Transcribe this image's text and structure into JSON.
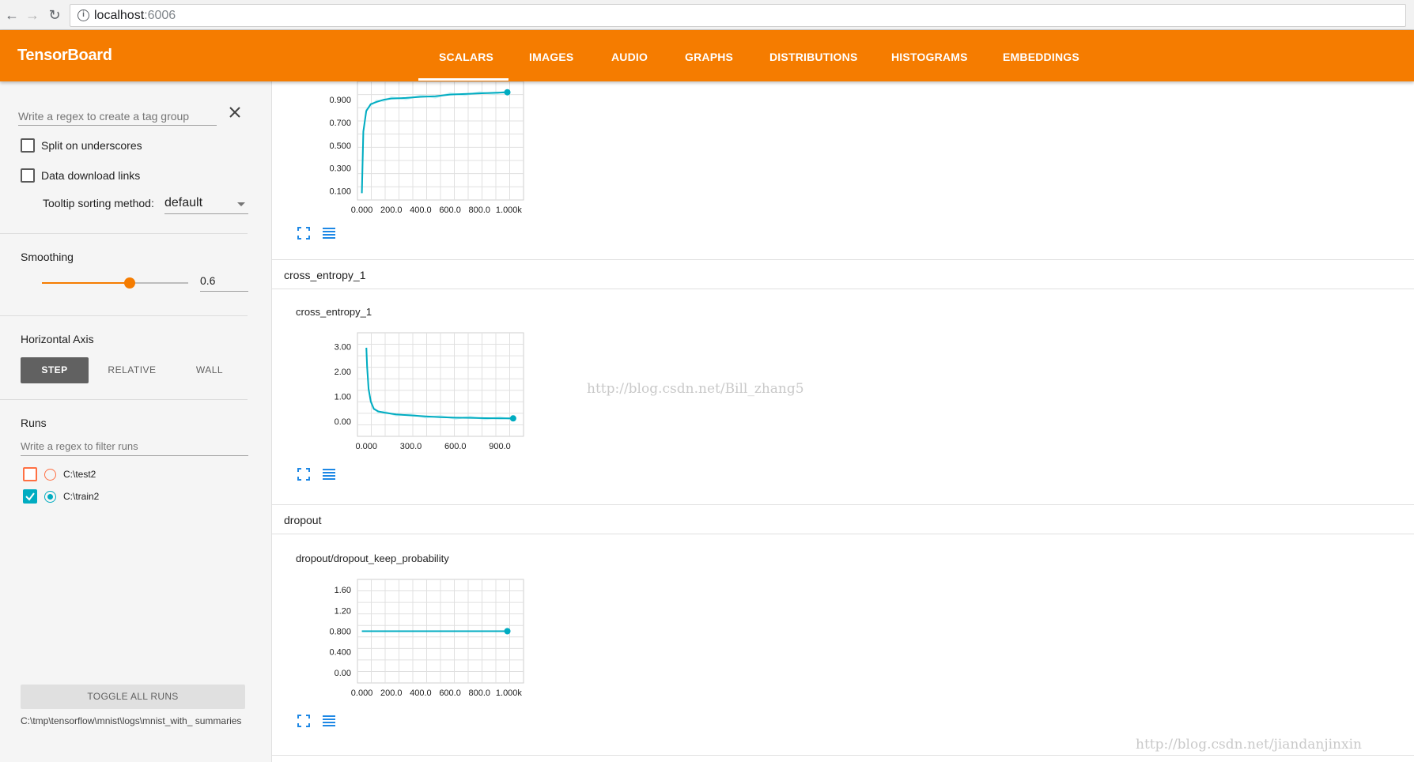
{
  "browser": {
    "url_host": "localhost",
    "url_port": ":6006",
    "back_icon": "back-arrow-icon",
    "forward_icon": "forward-arrow-icon",
    "reload_icon": "reload-icon"
  },
  "header": {
    "brand": "TensorBoard",
    "tabs": [
      "SCALARS",
      "IMAGES",
      "AUDIO",
      "GRAPHS",
      "DISTRIBUTIONS",
      "HISTOGRAMS",
      "EMBEDDINGS"
    ],
    "active_tab": "SCALARS",
    "colors": {
      "header_bg": "#f57c00",
      "accent": "#00acc1"
    }
  },
  "sidebar": {
    "tag_regex_placeholder": "Write a regex to create a tag group",
    "split_label": "Split on underscores",
    "download_label": "Data download links",
    "tooltip_label": "Tooltip sorting method:",
    "tooltip_value": "default",
    "smoothing_title": "Smoothing",
    "smoothing_value": "0.6",
    "smoothing_fraction": 0.6,
    "axis_title": "Horizontal Axis",
    "axis_options": [
      "STEP",
      "RELATIVE",
      "WALL"
    ],
    "axis_selected": "STEP",
    "runs_title": "Runs",
    "runs_placeholder": "Write a regex to filter runs",
    "runs": [
      {
        "name": "C:\\test2",
        "checked": false,
        "color": "#ff7043"
      },
      {
        "name": "C:\\train2",
        "checked": true,
        "color": "#00acc1"
      }
    ],
    "toggle_label": "TOGGLE ALL RUNS",
    "logdir": "C:\\tmp\\tensorflow\\mnist\\logs\\mnist_with_ summaries"
  },
  "groups": [
    {
      "title": "cross_entropy_1"
    },
    {
      "title": "dropout"
    }
  ],
  "chart_data": [
    {
      "type": "line",
      "title": "",
      "x": [
        0,
        10,
        30,
        60,
        100,
        150,
        200,
        300,
        400,
        500,
        600,
        700,
        800,
        900,
        990
      ],
      "series": [
        {
          "values": [
            0.08,
            0.62,
            0.8,
            0.86,
            0.88,
            0.9,
            0.91,
            0.915,
            0.925,
            0.93,
            0.945,
            0.95,
            0.955,
            0.96,
            0.965
          ]
        }
      ],
      "x_ticks": [
        "0.000",
        "200.0",
        "400.0",
        "600.0",
        "800.0",
        "1.000k"
      ],
      "y_ticks": [
        "0.900",
        "0.700",
        "0.500",
        "0.300",
        "0.100"
      ],
      "xlim": [
        -30,
        1100
      ],
      "ylim": [
        0.02,
        1.06
      ]
    },
    {
      "type": "line",
      "title": "cross_entropy_1",
      "x": [
        0,
        5,
        15,
        30,
        50,
        80,
        120,
        200,
        300,
        400,
        500,
        600,
        700,
        800,
        900,
        990
      ],
      "series": [
        {
          "values": [
            2.95,
            2.2,
            1.3,
            0.8,
            0.5,
            0.4,
            0.35,
            0.28,
            0.24,
            0.2,
            0.17,
            0.15,
            0.14,
            0.13,
            0.12,
            0.12
          ]
        }
      ],
      "x_ticks": [
        "0.000",
        "300.0",
        "600.0",
        "900.0"
      ],
      "y_ticks": [
        "3.00",
        "2.00",
        "1.00",
        "0.00"
      ],
      "xlim": [
        -60,
        1060
      ],
      "ylim": [
        -0.6,
        3.55
      ]
    },
    {
      "type": "line",
      "title": "dropout/dropout_keep_probability",
      "x": [
        0,
        990
      ],
      "series": [
        {
          "values": [
            0.8,
            0.8
          ]
        }
      ],
      "x_ticks": [
        "0.000",
        "200.0",
        "400.0",
        "600.0",
        "800.0",
        "1.000k"
      ],
      "y_ticks": [
        "1.60",
        "1.20",
        "0.800",
        "0.400",
        "0.00"
      ],
      "xlim": [
        -30,
        1100
      ],
      "ylim": [
        -0.2,
        1.8
      ]
    }
  ],
  "watermarks": [
    "http://blog.csdn.net/Bill_zhang5",
    "http://blog.csdn.net/jiandanjinxin"
  ]
}
